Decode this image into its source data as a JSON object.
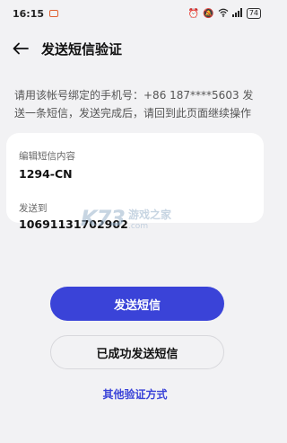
{
  "status_bar": {
    "time": "16:15",
    "battery": "74"
  },
  "header": {
    "title": "发送短信验证"
  },
  "instruction": "请用该帐号绑定的手机号：+86 187****5603 发送一条短信，发送完成后，请回到此页面继续操作",
  "card": {
    "content_label": "编辑短信内容",
    "content_value": "1294-CN",
    "recipient_label": "发送到",
    "recipient_value": "10691131702902"
  },
  "watermark": {
    "logo": "K73",
    "site_name": "游戏之家",
    "url": ".com"
  },
  "buttons": {
    "send": "发送短信",
    "sent": "已成功发送短信"
  },
  "link": "其他验证方式",
  "colors": {
    "accent": "#3a43d8",
    "background": "#f2f2f4"
  }
}
